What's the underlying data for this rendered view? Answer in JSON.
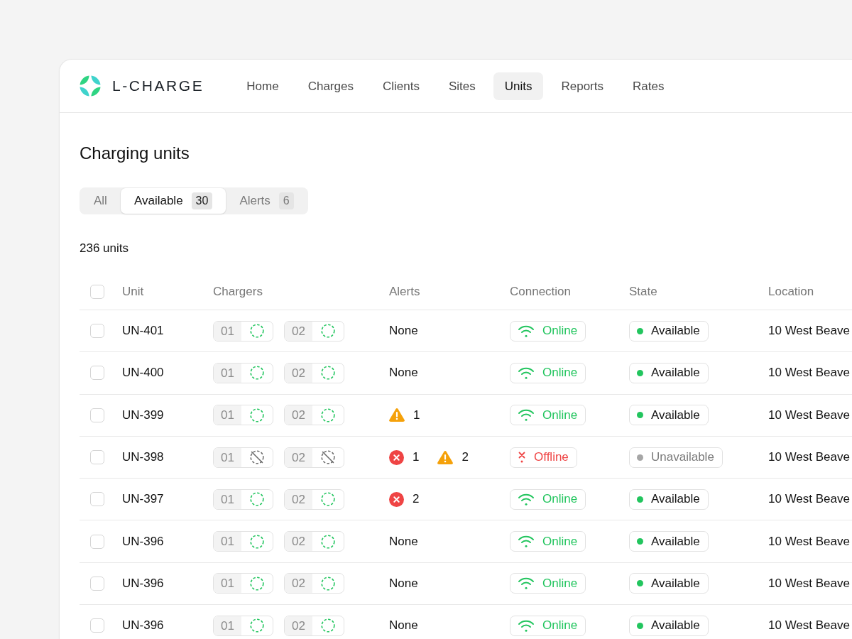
{
  "brand": {
    "name": "L-CHARGE"
  },
  "nav": {
    "items": [
      {
        "label": "Home",
        "selected": false
      },
      {
        "label": "Charges",
        "selected": false
      },
      {
        "label": "Clients",
        "selected": false
      },
      {
        "label": "Sites",
        "selected": false
      },
      {
        "label": "Units",
        "selected": true
      },
      {
        "label": "Reports",
        "selected": false
      },
      {
        "label": "Rates",
        "selected": false
      }
    ]
  },
  "page": {
    "title": "Charging units"
  },
  "filters": [
    {
      "label": "All",
      "selected": false
    },
    {
      "label": "Available",
      "count": "30",
      "selected": true
    },
    {
      "label": "Alerts",
      "count": "6",
      "selected": false
    }
  ],
  "summary": "236 units",
  "table": {
    "select_all": {
      "checked": false
    },
    "columns": [
      "Unit",
      "Chargers",
      "Alerts",
      "Connection",
      "State",
      "Location"
    ],
    "rows": [
      {
        "checked": false,
        "unit": "UN-401",
        "chargers": [
          {
            "label": "01",
            "kind": "available"
          },
          {
            "label": "02",
            "kind": "available"
          }
        ],
        "alerts": [
          {
            "kind": "none",
            "text": "None"
          }
        ],
        "connection": {
          "kind": "online",
          "label": "Online"
        },
        "state": {
          "kind": "available",
          "label": "Available"
        },
        "location": "10 West Beave"
      },
      {
        "checked": false,
        "unit": "UN-400",
        "chargers": [
          {
            "label": "01",
            "kind": "available"
          },
          {
            "label": "02",
            "kind": "available"
          }
        ],
        "alerts": [
          {
            "kind": "none",
            "text": "None"
          }
        ],
        "connection": {
          "kind": "online",
          "label": "Online"
        },
        "state": {
          "kind": "available",
          "label": "Available"
        },
        "location": "10 West Beave"
      },
      {
        "checked": false,
        "unit": "UN-399",
        "chargers": [
          {
            "label": "01",
            "kind": "available"
          },
          {
            "label": "02",
            "kind": "available"
          }
        ],
        "alerts": [
          {
            "kind": "warning",
            "text": "1"
          }
        ],
        "connection": {
          "kind": "online",
          "label": "Online"
        },
        "state": {
          "kind": "available",
          "label": "Available"
        },
        "location": "10 West Beave"
      },
      {
        "checked": false,
        "unit": "UN-398",
        "chargers": [
          {
            "label": "01",
            "kind": "unavailable"
          },
          {
            "label": "02",
            "kind": "unavailable"
          }
        ],
        "alerts": [
          {
            "kind": "error",
            "text": "1"
          },
          {
            "kind": "warning",
            "text": "2"
          }
        ],
        "connection": {
          "kind": "offline",
          "label": "Offline"
        },
        "state": {
          "kind": "unavailable",
          "label": "Unavailable"
        },
        "location": "10 West Beave"
      },
      {
        "checked": false,
        "unit": "UN-397",
        "chargers": [
          {
            "label": "01",
            "kind": "available"
          },
          {
            "label": "02",
            "kind": "available"
          }
        ],
        "alerts": [
          {
            "kind": "error",
            "text": "2"
          }
        ],
        "connection": {
          "kind": "online",
          "label": "Online"
        },
        "state": {
          "kind": "available",
          "label": "Available"
        },
        "location": "10 West Beave"
      },
      {
        "checked": false,
        "unit": "UN-396",
        "chargers": [
          {
            "label": "01",
            "kind": "available"
          },
          {
            "label": "02",
            "kind": "available"
          }
        ],
        "alerts": [
          {
            "kind": "none",
            "text": "None"
          }
        ],
        "connection": {
          "kind": "online",
          "label": "Online"
        },
        "state": {
          "kind": "available",
          "label": "Available"
        },
        "location": "10 West Beave"
      },
      {
        "checked": false,
        "unit": "UN-396",
        "chargers": [
          {
            "label": "01",
            "kind": "available"
          },
          {
            "label": "02",
            "kind": "available"
          }
        ],
        "alerts": [
          {
            "kind": "none",
            "text": "None"
          }
        ],
        "connection": {
          "kind": "online",
          "label": "Online"
        },
        "state": {
          "kind": "available",
          "label": "Available"
        },
        "location": "10 West Beave"
      },
      {
        "checked": false,
        "unit": "UN-396",
        "chargers": [
          {
            "label": "01",
            "kind": "available"
          },
          {
            "label": "02",
            "kind": "available"
          }
        ],
        "alerts": [
          {
            "kind": "none",
            "text": "None"
          }
        ],
        "connection": {
          "kind": "online",
          "label": "Online"
        },
        "state": {
          "kind": "available",
          "label": "Available"
        },
        "location": "10 West Beave"
      }
    ]
  }
}
